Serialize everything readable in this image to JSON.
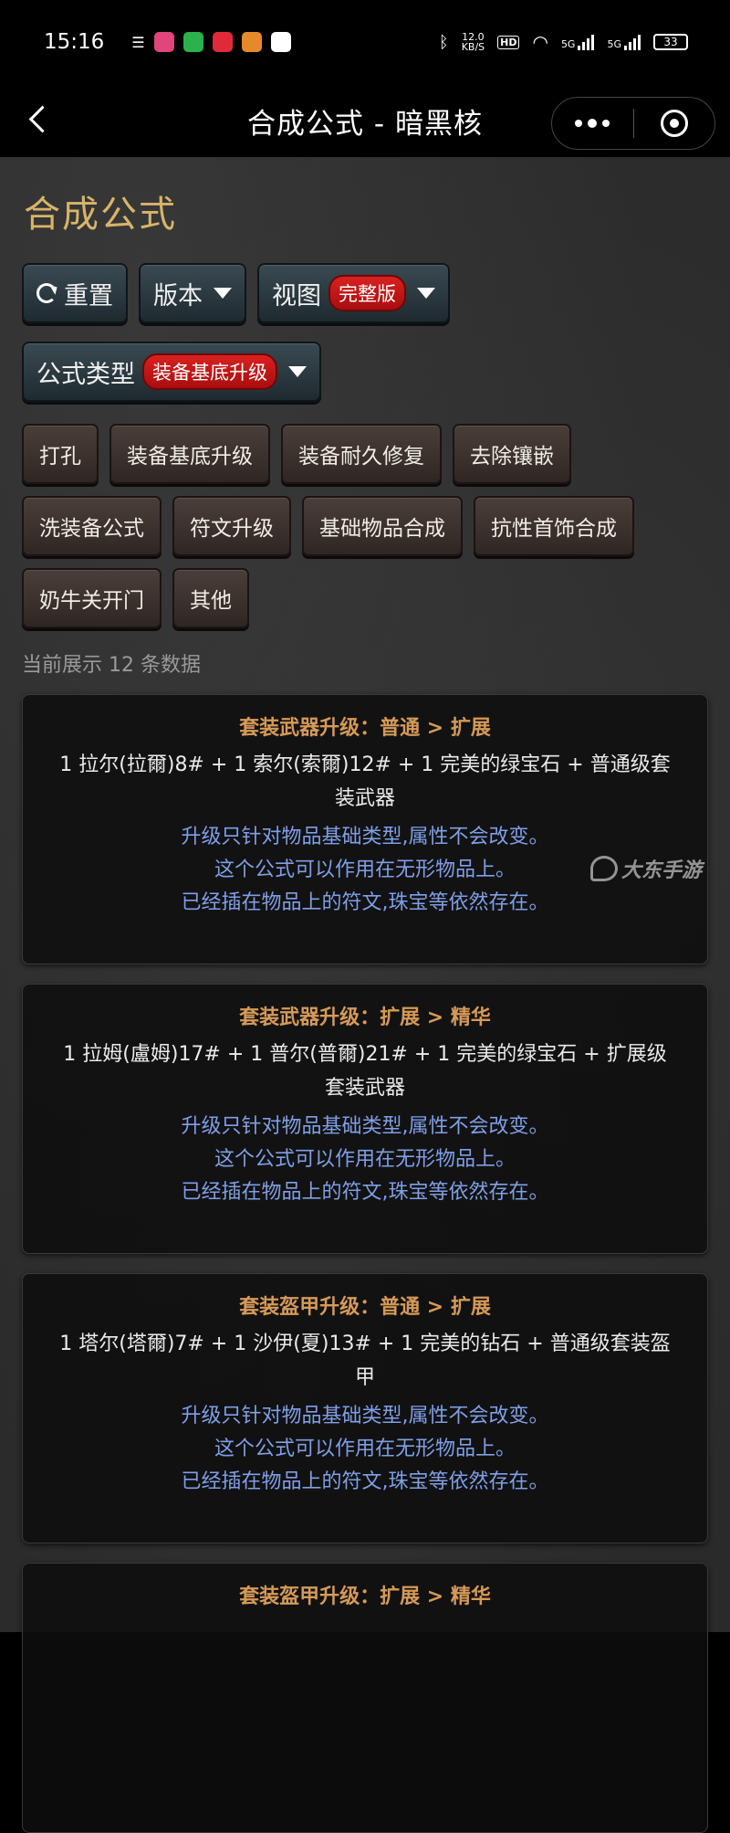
{
  "status_bar": {
    "time": "15:16",
    "speed_top": "12.0",
    "speed_bottom": "KB/S",
    "hd": "HD",
    "net1": "5G",
    "net2": "5G",
    "battery": "33"
  },
  "nav": {
    "title": "合成公式 - 暗黑核"
  },
  "page": {
    "title": "合成公式"
  },
  "controls": {
    "reset_label": "重置",
    "version_label": "版本",
    "view_label": "视图",
    "view_badge": "完整版",
    "formula_type_label": "公式类型",
    "formula_type_badge": "装备基底升级"
  },
  "categories": [
    "打孔",
    "装备基底升级",
    "装备耐久修复",
    "去除镶嵌",
    "洗装备公式",
    "符文升级",
    "基础物品合成",
    "抗性首饰合成",
    "奶牛关开门",
    "其他"
  ],
  "count_text": "当前展示 12 条数据",
  "cards": [
    {
      "title": "套装武器升级：普通 > 扩展",
      "formula": "1 拉尔(拉爾)8# + 1 索尔(索爾)12# + 1 完美的绿宝石 + 普通级套装武器",
      "notes": [
        "升级只针对物品基础类型,属性不会改变。",
        "这个公式可以作用在无形物品上。",
        "已经插在物品上的符文,珠宝等依然存在。"
      ]
    },
    {
      "title": "套装武器升级：扩展 > 精华",
      "formula": "1 拉姆(盧姆)17# + 1 普尔(普爾)21# + 1 完美的绿宝石 + 扩展级套装武器",
      "notes": [
        "升级只针对物品基础类型,属性不会改变。",
        "这个公式可以作用在无形物品上。",
        "已经插在物品上的符文,珠宝等依然存在。"
      ]
    },
    {
      "title": "套装盔甲升级：普通 > 扩展",
      "formula": "1 塔尔(塔爾)7# + 1 沙伊(夏)13# + 1 完美的钻石 + 普通级套装盔甲",
      "notes": [
        "升级只针对物品基础类型,属性不会改变。",
        "这个公式可以作用在无形物品上。",
        "已经插在物品上的符文,珠宝等依然存在。"
      ]
    },
    {
      "title": "套装盔甲升级：扩展 > 精华",
      "formula": "",
      "notes": []
    }
  ],
  "watermark": "大东手游"
}
